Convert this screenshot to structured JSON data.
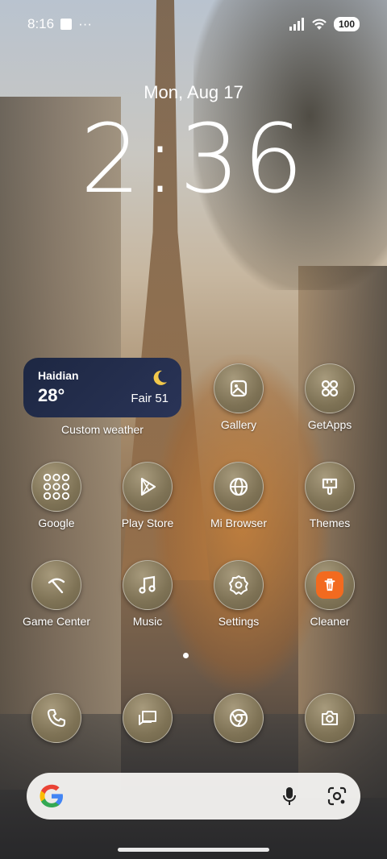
{
  "status_bar": {
    "time": "8:16",
    "more": "···",
    "battery": "100"
  },
  "lockscreen": {
    "date": "Mon, Aug 17",
    "time": "2:36"
  },
  "weather_widget": {
    "city": "Haidian",
    "temperature": "28°",
    "condition": "Fair 51",
    "label": "Custom weather",
    "icon": "moon-icon"
  },
  "apps": [
    {
      "label": "Gallery",
      "icon": "gallery-icon"
    },
    {
      "label": "GetApps",
      "icon": "getapps-icon"
    },
    {
      "label": "Google",
      "icon": "google-folder-icon"
    },
    {
      "label": "Play Store",
      "icon": "play-store-icon"
    },
    {
      "label": "Mi Browser",
      "icon": "globe-icon"
    },
    {
      "label": "Themes",
      "icon": "brush-icon"
    },
    {
      "label": "Game Center",
      "icon": "game-center-icon"
    },
    {
      "label": "Music",
      "icon": "music-note-icon"
    },
    {
      "label": "Settings",
      "icon": "gear-icon"
    },
    {
      "label": "Cleaner",
      "icon": "trash-icon"
    }
  ],
  "dock": [
    {
      "icon": "phone-icon"
    },
    {
      "icon": "messages-icon"
    },
    {
      "icon": "chrome-icon"
    },
    {
      "icon": "camera-icon"
    }
  ],
  "search_bar": {
    "icons": [
      "google-g-icon",
      "microphone-icon",
      "google-lens-icon"
    ]
  },
  "colors": {
    "icon_fill": "#7e7255",
    "widget_bg": "#1d2742",
    "cleaner_orange": "#f26a1f"
  }
}
